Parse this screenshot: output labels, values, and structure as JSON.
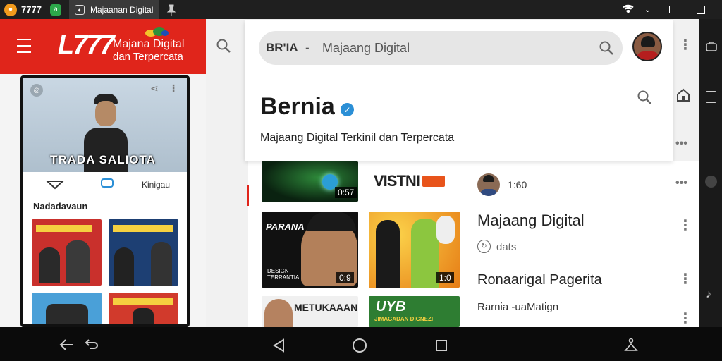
{
  "statusbar": {
    "app_count": "7777",
    "tab_title": "Majaanan Digital"
  },
  "brand": {
    "logo": "L777",
    "tagline_line1": "Majana Digital",
    "tagline_line2": "dan Terpercata"
  },
  "phone": {
    "hero_text": "TRADA SALIOTA",
    "tab_label": "Kinigau",
    "section_title": "Nadadavaun"
  },
  "search": {
    "query_prefix": "BR'IA",
    "separator": "-",
    "query_text": "Majaang Digital"
  },
  "channel": {
    "name": "Bernia",
    "subtitle": "Majaang Digital Terkinil dan Terpercata"
  },
  "list": {
    "row1_duration": "0:57",
    "row1_brand": "VISTNI",
    "row1_meta": "1:60",
    "row2_duration": "0:9",
    "row2_duration_b": "1:0",
    "row2_caption_top": "PARANA",
    "row2_caption_bottom": "DESIGN TERRANTIA",
    "row2_title": "Majaang Digital",
    "row2_meta": "dats",
    "row3_title": "Ronaarigal Pagerita",
    "row3_subtitle": "Rarnia -uaMatign",
    "row3_thumb1_text": "METUKAAAN",
    "row3_thumb2_text": "UYB",
    "row3_thumb2_sub": "JIMAGADAN DIGNEZI"
  },
  "colors": {
    "brand_red": "#e0251b",
    "verified_blue": "#2b8fd6",
    "topbar": "#1f1f1f"
  }
}
